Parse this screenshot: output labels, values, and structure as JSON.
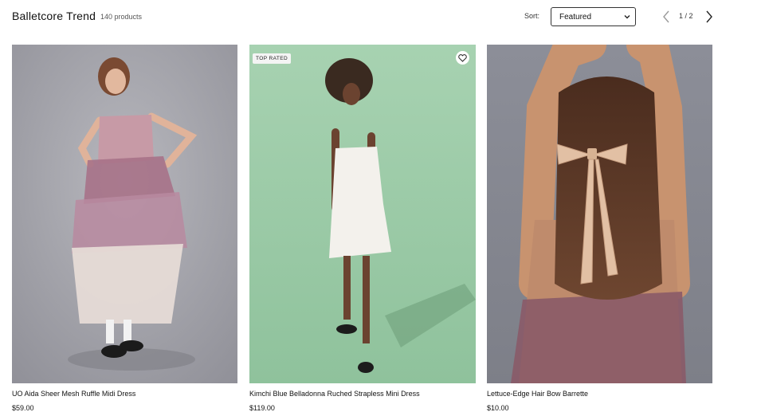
{
  "header": {
    "title": "Balletcore Trend",
    "count": "140 products",
    "sort_label": "Sort:",
    "sort_value": "Featured",
    "page_indicator": "1 / 2"
  },
  "products": [
    {
      "name": "UO Aida Sheer Mesh Ruffle Midi Dress",
      "price": "$59.00"
    },
    {
      "name": "Kimchi Blue Belladonna Ruched Strapless Mini Dress",
      "price": "$119.00",
      "badge": "TOP RATED"
    },
    {
      "name": "Lettuce-Edge Hair Bow Barrette",
      "price": "$10.00"
    }
  ],
  "colors": {
    "photo1_bg": "#9b9ba3",
    "photo2_bg": "#9cc9a7",
    "photo3_bg": "#8b8d96"
  },
  "icons": {
    "prev": "chevron-left-icon",
    "next": "chevron-right-icon",
    "favorite": "heart-icon",
    "dropdown": "chevron-down-icon"
  }
}
